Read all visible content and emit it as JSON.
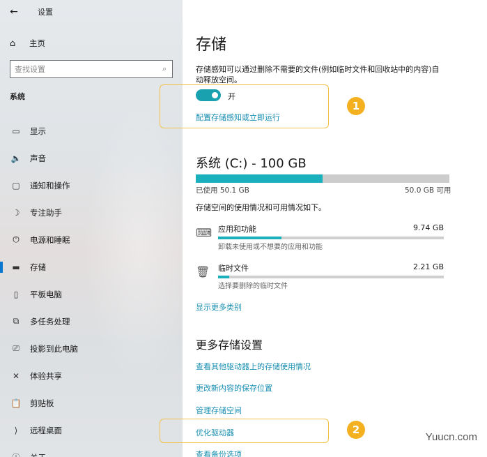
{
  "window": {
    "title": "设置",
    "back_glyph": "←"
  },
  "sidebar": {
    "home_label": "主页",
    "search_placeholder": "查找设置",
    "section_label": "系统",
    "items": [
      {
        "icon": "display-icon",
        "glyph": "▭",
        "label": "显示"
      },
      {
        "icon": "sound-icon",
        "glyph": "🔈",
        "label": "声音"
      },
      {
        "icon": "notification-icon",
        "glyph": "▢",
        "label": "通知和操作"
      },
      {
        "icon": "focus-assist-icon",
        "glyph": "☽",
        "label": "专注助手"
      },
      {
        "icon": "power-icon",
        "glyph": "⏻",
        "label": "电源和睡眠"
      },
      {
        "icon": "storage-icon",
        "glyph": "▬",
        "label": "存储",
        "active": true
      },
      {
        "icon": "tablet-icon",
        "glyph": "▯",
        "label": "平板电脑"
      },
      {
        "icon": "multitasking-icon",
        "glyph": "⧉",
        "label": "多任务处理"
      },
      {
        "icon": "project-icon",
        "glyph": "⎚",
        "label": "投影到此电脑"
      },
      {
        "icon": "shared-experiences-icon",
        "glyph": "✕",
        "label": "体验共享"
      },
      {
        "icon": "clipboard-icon",
        "glyph": "📋",
        "label": "剪贴板"
      },
      {
        "icon": "remote-desktop-icon",
        "glyph": "⟩",
        "label": "远程桌面"
      },
      {
        "icon": "about-icon",
        "glyph": "ⓘ",
        "label": "关于"
      }
    ]
  },
  "main": {
    "title": "存储",
    "description": "存储感知可以通过删除不需要的文件(例如临时文件和回收站中的内容)自动释放空间。",
    "toggle": {
      "state": "on",
      "label": "开"
    },
    "configure_link": "配置存储感知或立即运行",
    "drive": {
      "title": "系统 (C:) - 100 GB",
      "used_label": "已使用 50.1 GB",
      "free_label": "50.0 GB 可用",
      "used_fraction": 0.501
    },
    "usage_desc": "存储空间的使用情况和可用情况如下。",
    "categories": [
      {
        "icon": "apps-icon",
        "name": "应用和功能",
        "size": "9.74 GB",
        "sub": "卸载未使用或不想要的应用和功能",
        "fraction": 0.28
      },
      {
        "icon": "trash-icon",
        "name": "临时文件",
        "size": "2.21 GB",
        "sub": "选择要删除的临时文件",
        "fraction": 0.05
      }
    ],
    "show_more": "显示更多类别",
    "more_title": "更多存储设置",
    "more_links": [
      "查看其他驱动器上的存储使用情况",
      "更改新内容的保存位置",
      "管理存储空间",
      "优化驱动器",
      "查看备份选项"
    ]
  },
  "annotations": {
    "badge1": "1",
    "badge2": "2"
  },
  "watermark": "Yuucn.com",
  "colors": {
    "accent": "#1ab0be",
    "link": "#1a8fb2",
    "highlight": "#f2c24a",
    "badge": "#f3b120"
  }
}
